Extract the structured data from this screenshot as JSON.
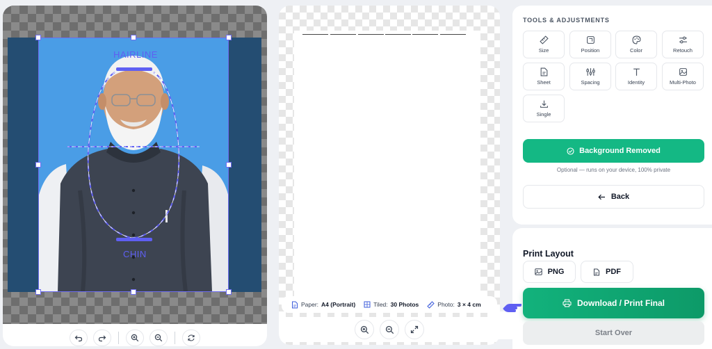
{
  "editor": {
    "guides": {
      "hairline_label": "HAIRLINE",
      "chin_label": "CHIN"
    },
    "toolbar": {
      "icons": [
        "undo-icon",
        "redo-icon",
        "zoom-in-icon",
        "zoom-out-icon",
        "reset-icon"
      ]
    },
    "colors": {
      "photo_bg": "#4a9de6",
      "side_bg": "#244d72",
      "guide": "#5f5ff2"
    }
  },
  "preview": {
    "info": {
      "paper_label": "Paper:",
      "paper_value": "A4 (Portrait)",
      "tiled_label": "Tiled:",
      "tiled_value": "30 Photos",
      "photo_label": "Photo:",
      "photo_value": "3 × 4 cm"
    },
    "zoom_icons": [
      "zoom-in-icon",
      "zoom-out-icon",
      "fullscreen-icon"
    ]
  },
  "tools": {
    "title": "TOOLS & ADJUSTMENTS",
    "items": [
      {
        "label": "Size",
        "icon": "ruler-icon"
      },
      {
        "label": "Position",
        "icon": "crop-icon"
      },
      {
        "label": "Color",
        "icon": "palette-icon"
      },
      {
        "label": "Retouch",
        "icon": "sliders-icon"
      },
      {
        "label": "Sheet",
        "icon": "document-icon"
      },
      {
        "label": "Spacing",
        "icon": "spacing-icon"
      },
      {
        "label": "Identity",
        "icon": "text-icon"
      },
      {
        "label": "Multi-Photo",
        "icon": "images-icon"
      },
      {
        "label": "Single",
        "icon": "download-icon"
      }
    ],
    "bg_removed_label": "Background Removed",
    "optional_note": "Optional — runs on your device, 100% private",
    "back_label": "Back"
  },
  "print": {
    "title": "Print Layout",
    "png_label": "PNG",
    "pdf_label": "PDF",
    "download_label": "Download / Print Final",
    "start_over_label": "Start Over",
    "colors": {
      "primary": "#12b27c",
      "accent_hand": "#5f5ff2"
    }
  }
}
